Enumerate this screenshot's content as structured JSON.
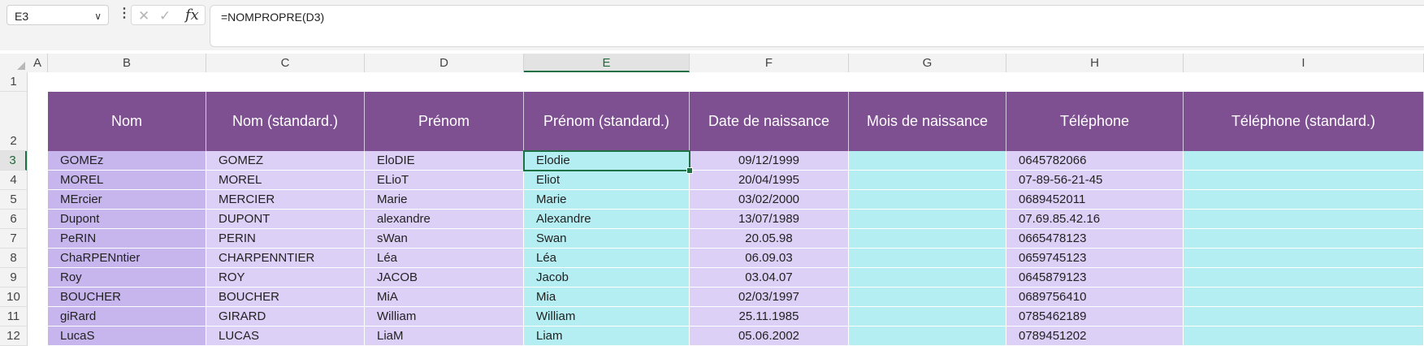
{
  "formula_bar": {
    "name_box": "E3",
    "formula": "=NOMPROPRE(D3)",
    "icons": [
      "chevron-down-icon",
      "more-options-icon",
      "cancel-icon",
      "enter-icon",
      "insert-function-icon"
    ],
    "cancel_glyph": "✕",
    "enter_glyph": "✓",
    "fx_label": "fx"
  },
  "columns": [
    "A",
    "B",
    "C",
    "D",
    "E",
    "F",
    "G",
    "H",
    "I"
  ],
  "active_column": "E",
  "active_row": "3",
  "rows": [
    "1",
    "2",
    "3",
    "4",
    "5",
    "6",
    "7",
    "8",
    "9",
    "10",
    "11",
    "12"
  ],
  "headers": [
    "Nom",
    "Nom (standard.)",
    "Prénom",
    "Prénom (standard.)",
    "Date de naissance",
    "Mois de naissance",
    "Téléphone",
    "Téléphone (standard.)"
  ],
  "table": [
    [
      "GOMEz",
      "GOMEZ",
      "EloDIE",
      "Elodie",
      "09/12/1999",
      "",
      "0645782066",
      ""
    ],
    [
      "MOREL",
      "MOREL",
      "ELioT",
      "Eliot",
      "20/04/1995",
      "",
      "07-89-56-21-45",
      ""
    ],
    [
      "MErcier",
      "MERCIER",
      "Marie",
      "Marie",
      "03/02/2000",
      "",
      "0689452011",
      ""
    ],
    [
      "Dupont",
      "DUPONT",
      "alexandre",
      "Alexandre",
      "13/07/1989",
      "",
      "07.69.85.42.16",
      ""
    ],
    [
      "PeRIN",
      "PERIN",
      "sWan",
      "Swan",
      "20.05.98",
      "",
      "0665478123",
      ""
    ],
    [
      "ChaRPENntier",
      "CHARPENNTIER",
      "Léa",
      "Léa",
      "06.09.03",
      "",
      "0659745123",
      ""
    ],
    [
      "Roy",
      "ROY",
      "JACOB",
      "Jacob",
      "03.04.07",
      "",
      "0645879123",
      ""
    ],
    [
      "BOUCHER",
      "BOUCHER",
      "MiA",
      "Mia",
      "02/03/1997",
      "",
      "0689756410",
      ""
    ],
    [
      "giRard",
      "GIRARD",
      "William",
      "William",
      "25.11.1985",
      "",
      "0785462189",
      ""
    ],
    [
      "LucaS",
      "LUCAS",
      "LiaM",
      "Liam",
      "05.06.2002",
      "",
      "0789451202",
      ""
    ]
  ],
  "colors": {
    "header_purple": "#7e4f91",
    "col_b": "#c7b5ee",
    "cyan": "#b4eef2",
    "lavender": "#ddd0f7",
    "selection_green": "#1e7145"
  }
}
